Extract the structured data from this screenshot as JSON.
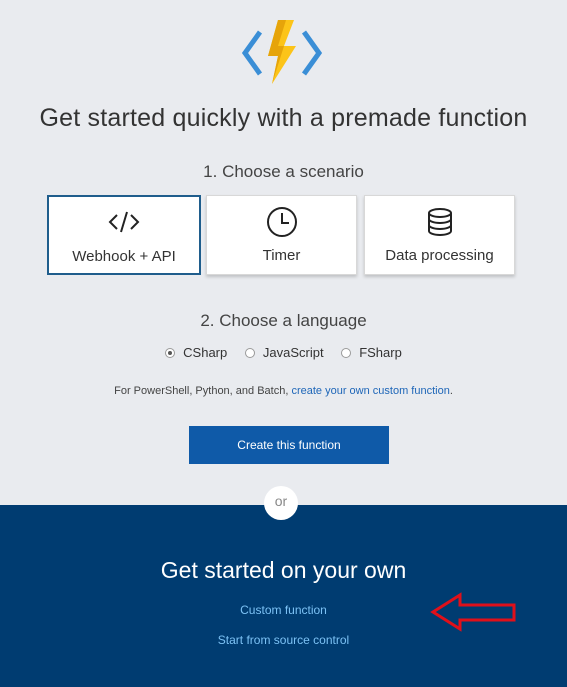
{
  "header": {
    "headline": "Get started quickly with a premade function"
  },
  "scenario": {
    "heading": "1. Choose a scenario",
    "cards": [
      {
        "label": "Webhook + API",
        "icon": "code-brackets-icon",
        "selected": true
      },
      {
        "label": "Timer",
        "icon": "clock-icon",
        "selected": false
      },
      {
        "label": "Data processing",
        "icon": "database-icon",
        "selected": false
      }
    ]
  },
  "language": {
    "heading": "2. Choose a language",
    "options": [
      {
        "label": "CSharp",
        "selected": true
      },
      {
        "label": "JavaScript",
        "selected": false
      },
      {
        "label": "FSharp",
        "selected": false
      }
    ],
    "note_prefix": "For PowerShell, Python, and Batch, ",
    "note_link": "create your own custom function",
    "note_suffix": "."
  },
  "actions": {
    "create_label": "Create this function",
    "or_label": "or"
  },
  "own": {
    "title": "Get started on your own",
    "links": [
      "Custom function",
      "Start from source control"
    ]
  },
  "colors": {
    "top_bg": "#e9ebef",
    "bottom_bg": "#003c71",
    "primary_button": "#0f5aa8",
    "link_light": "#7cc2f5",
    "annotation_arrow": "#e0101a"
  }
}
